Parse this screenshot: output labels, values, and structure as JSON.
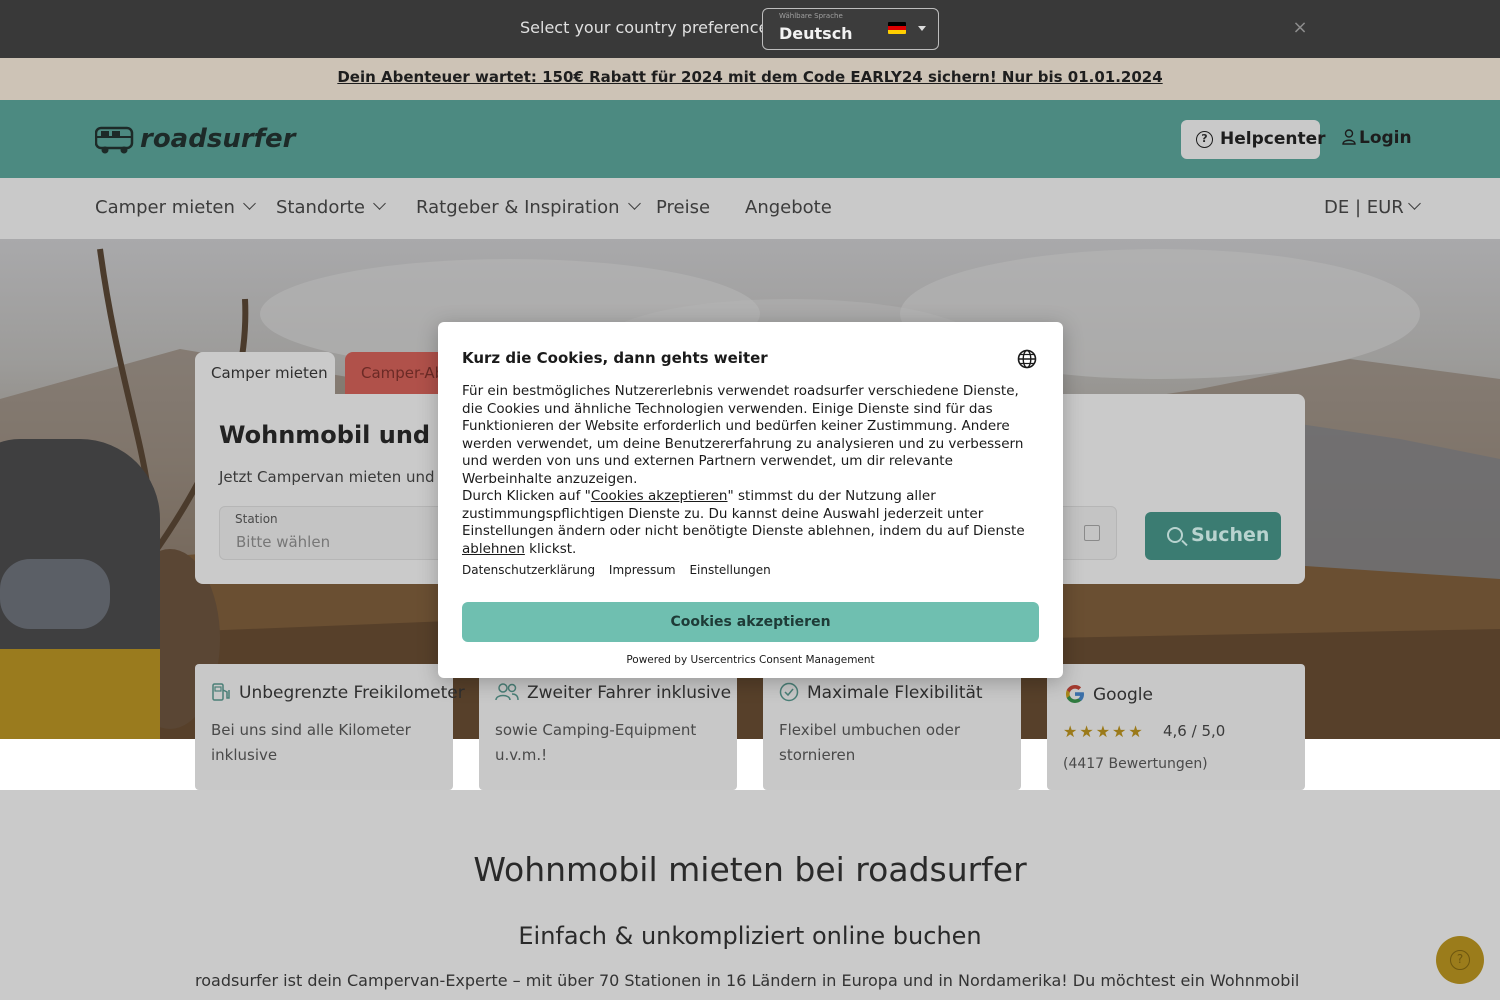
{
  "country_bar": {
    "prompt": "Select your country preferences",
    "language_small_label": "Wählbare Sprache",
    "language_value": "Deutsch",
    "flag": "germany-flag",
    "close_icon": "close-icon"
  },
  "promo": {
    "text": "Dein Abenteuer wartet: 150€ Rabatt für 2024 mit dem Code EARLY24 sichern! Nur bis 01.01.2024"
  },
  "header": {
    "logo_text": "roadsurfer",
    "help_label": "Helpcenter",
    "login_label": "Login"
  },
  "nav": {
    "items": [
      {
        "label": "Camper mieten",
        "has_dropdown": true
      },
      {
        "label": "Standorte",
        "has_dropdown": true
      },
      {
        "label": "Ratgeber & Inspiration",
        "has_dropdown": true
      },
      {
        "label": "Preise",
        "has_dropdown": false
      },
      {
        "label": "Angebote",
        "has_dropdown": false
      }
    ],
    "locale": "DE | EUR"
  },
  "search": {
    "tabs": [
      "Camper mieten",
      "Camper-Ab"
    ],
    "title": "Wohnmobil und Ca",
    "subtitle": "Jetzt Campervan mieten und ab",
    "station_label": "Station",
    "station_placeholder": "Bitte wählen",
    "search_label": "Suchen"
  },
  "features": [
    {
      "title": "Unbegrenzte Freikilometer",
      "desc": "Bei uns sind alle Kilometer inklusive",
      "icon": "fuel-pump-icon"
    },
    {
      "title": "Zweiter Fahrer inklusive",
      "desc": "sowie Camping-Equipment u.v.m.!",
      "icon": "users-icon"
    },
    {
      "title": "Maximale Flexibilität",
      "desc": "Flexibel umbuchen oder stornieren",
      "icon": "check-circle-icon"
    }
  ],
  "google": {
    "title": "Google",
    "stars": "★★★★★",
    "rating": "4,6 / 5,0",
    "reviews": "(4417 Bewertungen)"
  },
  "content": {
    "h1": "Wohnmobil mieten bei roadsurfer",
    "h2": "Einfach & unkompliziert online buchen",
    "paragraph": "roadsurfer ist dein Campervan-Experte – mit über 70 Stationen in 16 Ländern in Europa und in Nordamerika! Du möchtest ein Wohnmobil mieten und dein"
  },
  "cookie": {
    "title": "Kurz die Cookies, dann gehts weiter",
    "p1": "Für ein bestmögliches Nutzererlebnis verwendet roadsurfer verschiedene Dienste, die Cookies und ähnliche Technologien verwenden. Einige Dienste sind für das Funktionieren der Website erforderlich und bedürfen keiner Zustimmung. Andere werden verwendet, um deine Benutzererfahrung zu analysieren und zu verbessern und werden von uns und externen Partnern verwendet, um dir relevante Werbeinhalte anzuzeigen.",
    "p2_a": "Durch Klicken auf \"",
    "p2_link": "Cookies akzeptieren",
    "p2_b": "\" stimmst du der Nutzung aller zustimmungspflichtigen Dienste zu. Du kannst deine Auswahl jederzeit unter Einstellungen ändern oder nicht benötigte Dienste ablehnen, indem du auf Dienste ",
    "p2_link2": "ablehnen",
    "p2_c": " klickst.",
    "links": [
      "Datenschutzerklärung",
      "Impressum",
      "Einstellungen"
    ],
    "accept_label": "Cookies akzeptieren",
    "powered": "Powered by Usercentrics Consent Management"
  },
  "colors": {
    "brand_teal": "#6fbfb0",
    "header_dimmed": "#4c8a81",
    "accent_gold": "#9b7c1b"
  }
}
